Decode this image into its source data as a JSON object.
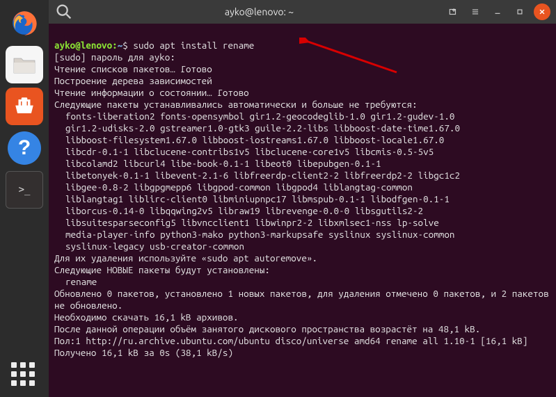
{
  "titlebar": {
    "title": "ayko@lenovo: ~"
  },
  "prompt": {
    "user_host": "ayko@lenovo",
    "colon": ":",
    "path": "~",
    "dollar": "$ ",
    "command": "sudo apt install rename"
  },
  "output": {
    "l1": "[sudo] пароль для ayko:",
    "l2": "Чтение списков пакетов… Готово",
    "l3": "Построение дерева зависимостей",
    "l4": "Чтение информации о состоянии… Готово",
    "l5": "Следующие пакеты устанавливались автоматически и больше не требуются:",
    "pkg1": "fonts-liberation2 fonts-opensymbol gir1.2-geocodeglib-1.0 gir1.2-gudev-1.0",
    "pkg2": "gir1.2-udisks-2.0 gstreamer1.0-gtk3 guile-2.2-libs libboost-date-time1.67.0",
    "pkg3": "libboost-filesystem1.67.0 libboost-iostreams1.67.0 libboost-locale1.67.0",
    "pkg4": "libcdr-0.1-1 libclucene-contribs1v5 libclucene-core1v5 libcmis-0.5-5v5",
    "pkg5": "libcolamd2 libcurl4 libe-book-0.1-1 libeot0 libepubgen-0.1-1",
    "pkg6": "libetonyek-0.1-1 libevent-2.1-6 libfreerdp-client2-2 libfreerdp2-2 libgc1c2",
    "pkg7": "libgee-0.8-2 libgpgmepp6 libgpod-common libgpod4 liblangtag-common",
    "pkg8": "liblangtag1 liblirc-client0 libminiupnpc17 libmspub-0.1-1 libodfgen-0.1-1",
    "pkg9": "liborcus-0.14-0 libqqwing2v5 libraw19 librevenge-0.0-0 libsgutils2-2",
    "pkg10": "libsuitesparseconfig5 libvncclient1 libwinpr2-2 libxmlsec1-nss lp-solve",
    "pkg11": "media-player-info python3-mako python3-markupsafe syslinux syslinux-common",
    "pkg12": "syslinux-legacy usb-creator-common",
    "l6": "Для их удаления используйте «sudo apt autoremove».",
    "l7": "Следующие НОВЫЕ пакеты будут установлены:",
    "new_pkg": "rename",
    "l8": "Обновлено 0 пакетов, установлено 1 новых пакетов, для удаления отмечено 0 пакетов, и 2 пакетов не обновлено.",
    "l9": "Необходимо скачать 16,1 kB архивов.",
    "l10": "После данной операции объём занятого дискового пространства возрастёт на 48,1 kB.",
    "l11": "Пол:1 http://ru.archive.ubuntu.com/ubuntu disco/universe amd64 rename all 1.10-1 [16,1 kB]",
    "l12": "Получено 16,1 kB за 0s (38,1 kB/s)"
  },
  "help_icon_label": "?"
}
